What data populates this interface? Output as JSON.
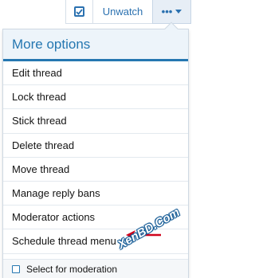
{
  "toolbar": {
    "unwatch_label": "Unwatch",
    "more_label": "•••"
  },
  "menu": {
    "title": "More options",
    "items": [
      {
        "label": "Edit thread"
      },
      {
        "label": "Lock thread"
      },
      {
        "label": "Stick thread"
      },
      {
        "label": "Delete thread"
      },
      {
        "label": "Move thread"
      },
      {
        "label": "Manage reply bans"
      },
      {
        "label": "Moderator actions"
      },
      {
        "label": "Schedule thread menu"
      }
    ],
    "footer_label": "Select for moderation"
  },
  "watermark": {
    "text": "XenBD.Com"
  },
  "colors": {
    "accent": "#2577b1",
    "header_bg": "#edf4fa",
    "arrow": "#d0021b"
  },
  "icons": {
    "check": "checkbox-checked-icon",
    "more": "more-dots-icon",
    "caret": "chevron-down-icon",
    "arrow": "red-pointer-arrow-icon"
  }
}
